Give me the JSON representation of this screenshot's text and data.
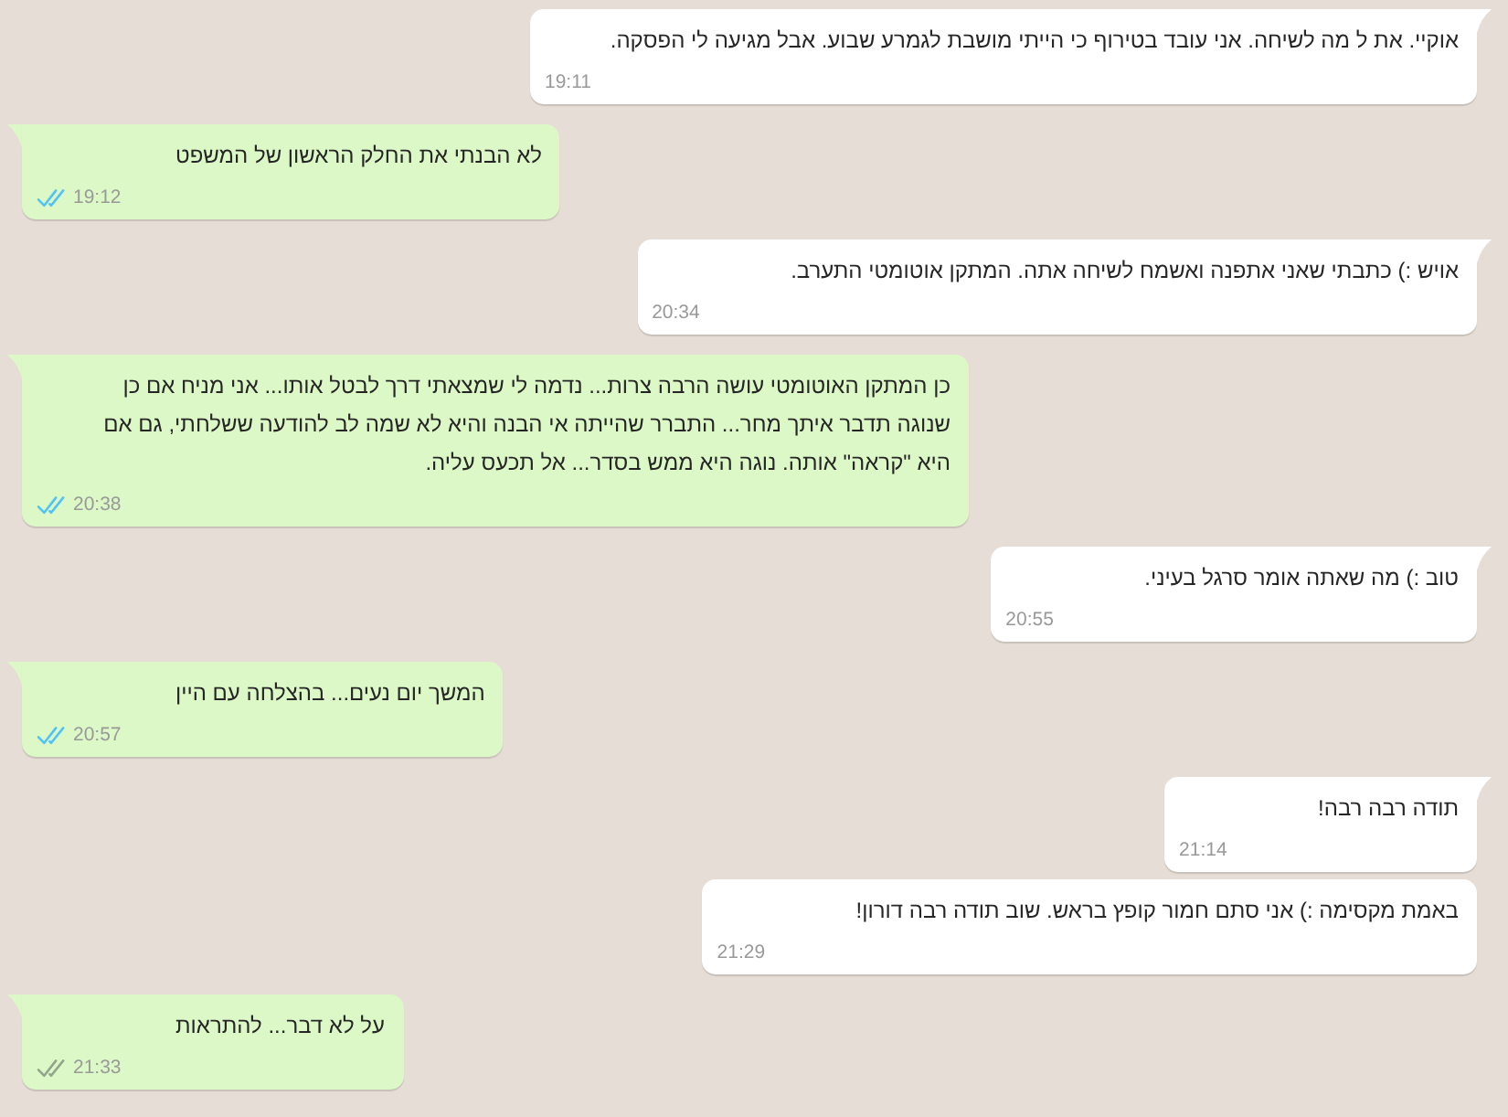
{
  "messages": [
    {
      "kind": "received",
      "text": "אוקיי. את ל מה לשיחה. אני עובד בטירוף כי הייתי מושבת לגמרע שבוע. אבל מגיעה לי הפסקה.",
      "time": "19:11"
    },
    {
      "kind": "sent",
      "text": "לא הבנתי את החלק הראשון של המשפט",
      "time": "19:12",
      "read": true
    },
    {
      "kind": "received",
      "text": "אויש :) כתבתי שאני אתפנה ואשמח לשיחה אתה. המתקן אוטומטי התערב.",
      "time": "20:34"
    },
    {
      "kind": "sent",
      "text": "כן המתקן האוטומטי עושה הרבה צרות... נדמה לי שמצאתי דרך לבטל אותו... אני מניח אם כן שנוגה תדבר איתך מחר... התברר שהייתה אי הבנה והיא לא שמה לב להודעה ששלחתי, גם אם היא \"קראה\" אותה. נוגה היא ממש בסדר... אל תכעס עליה.",
      "time": "20:38",
      "read": true
    },
    {
      "kind": "received",
      "text": "טוב :) מה שאתה אומר סרגל בעיני.",
      "time": "20:55"
    },
    {
      "kind": "sent",
      "text": "המשך יום נעים... בהצלחה עם היין",
      "time": "20:57",
      "read": true
    },
    {
      "kind": "received",
      "text": "תודה רבה רבה!",
      "time": "21:14"
    },
    {
      "kind": "received",
      "text": "באמת מקסימה :) אני סתם חמור קופץ בראש. שוב תודה רבה דורון!",
      "time": "21:29"
    },
    {
      "kind": "sent",
      "text": "על לא דבר... להתראות",
      "time": "21:33",
      "read": false
    }
  ]
}
